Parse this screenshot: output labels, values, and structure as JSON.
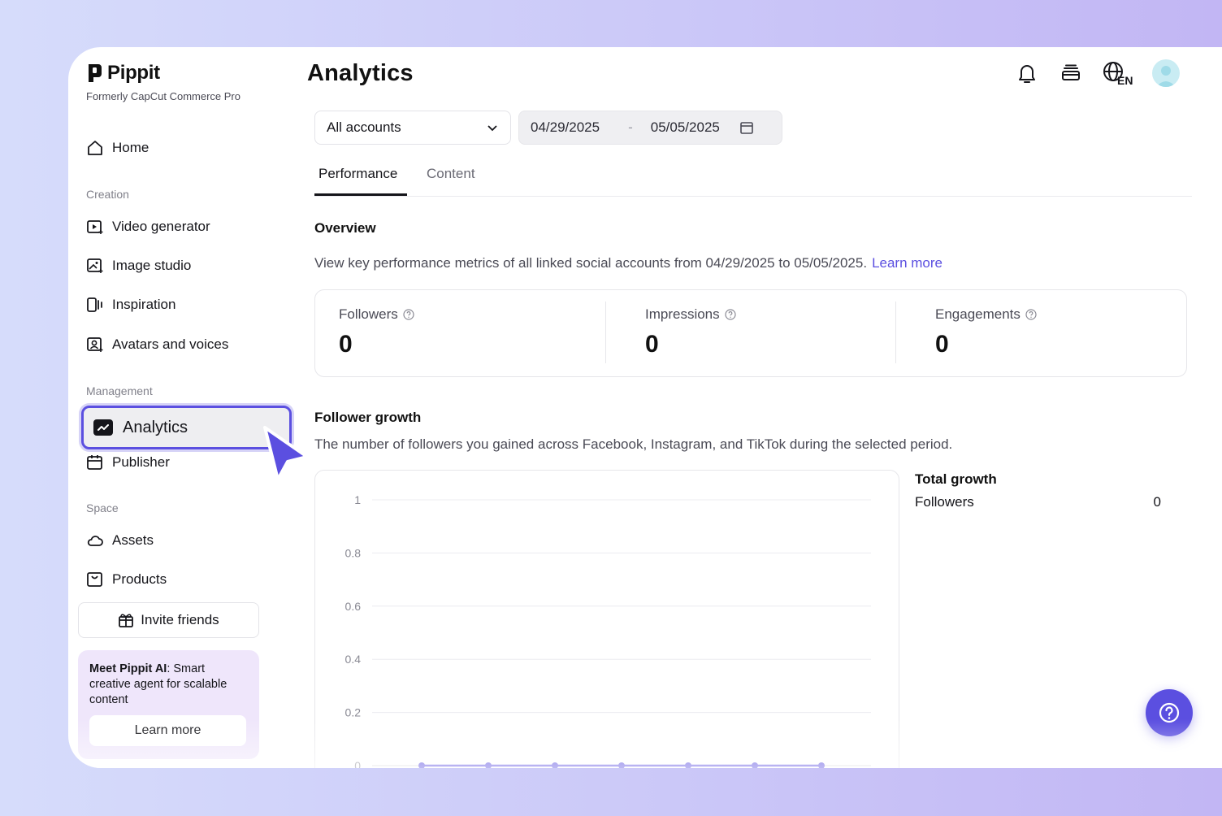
{
  "brand": {
    "name": "Pippit",
    "subtitle": "Formerly CapCut Commerce Pro"
  },
  "sidebar": {
    "home": "Home",
    "creation_label": "Creation",
    "creation_items": [
      "Video generator",
      "Image studio",
      "Inspiration",
      "Avatars and voices"
    ],
    "management_label": "Management",
    "analytics": "Analytics",
    "publisher": "Publisher",
    "space_label": "Space",
    "assets": "Assets",
    "products": "Products",
    "invite": "Invite friends",
    "promo": {
      "bold": "Meet Pippit AI",
      "text": ": Smart creative agent for scalable content",
      "button": "Learn more"
    }
  },
  "header": {
    "title": "Analytics",
    "language_badge": "EN",
    "icons": [
      "bell-icon",
      "stack-icon",
      "globe-icon",
      "avatar"
    ]
  },
  "filters": {
    "account": "All accounts",
    "start_date": "04/29/2025",
    "separator": "-",
    "end_date": "05/05/2025"
  },
  "tabs": [
    {
      "label": "Performance",
      "active": true
    },
    {
      "label": "Content",
      "active": false
    }
  ],
  "overview": {
    "title": "Overview",
    "description": "View key performance metrics of all linked social accounts from 04/29/2025 to 05/05/2025.",
    "link": "Learn more",
    "metrics": [
      {
        "label": "Followers",
        "value": "0"
      },
      {
        "label": "Impressions",
        "value": "0"
      },
      {
        "label": "Engagements",
        "value": "0"
      }
    ]
  },
  "growth": {
    "title": "Follower growth",
    "description": "The number of followers you gained across Facebook, Instagram, and TikTok during the selected period.",
    "total_title": "Total growth",
    "total_label": "Followers",
    "total_value": "0"
  },
  "colors": {
    "accent": "#5b4fe0",
    "promo_bg": "#efe6fb"
  },
  "chart_data": {
    "type": "line",
    "title": "",
    "xlabel": "",
    "ylabel": "",
    "ylim": [
      0,
      1
    ],
    "y_ticks": [
      "1",
      "0.8",
      "0.6",
      "0.4",
      "0.2",
      "0"
    ],
    "grid": true,
    "series": [
      {
        "values": [
          0,
          0,
          0,
          0,
          0,
          0,
          0
        ]
      }
    ]
  }
}
